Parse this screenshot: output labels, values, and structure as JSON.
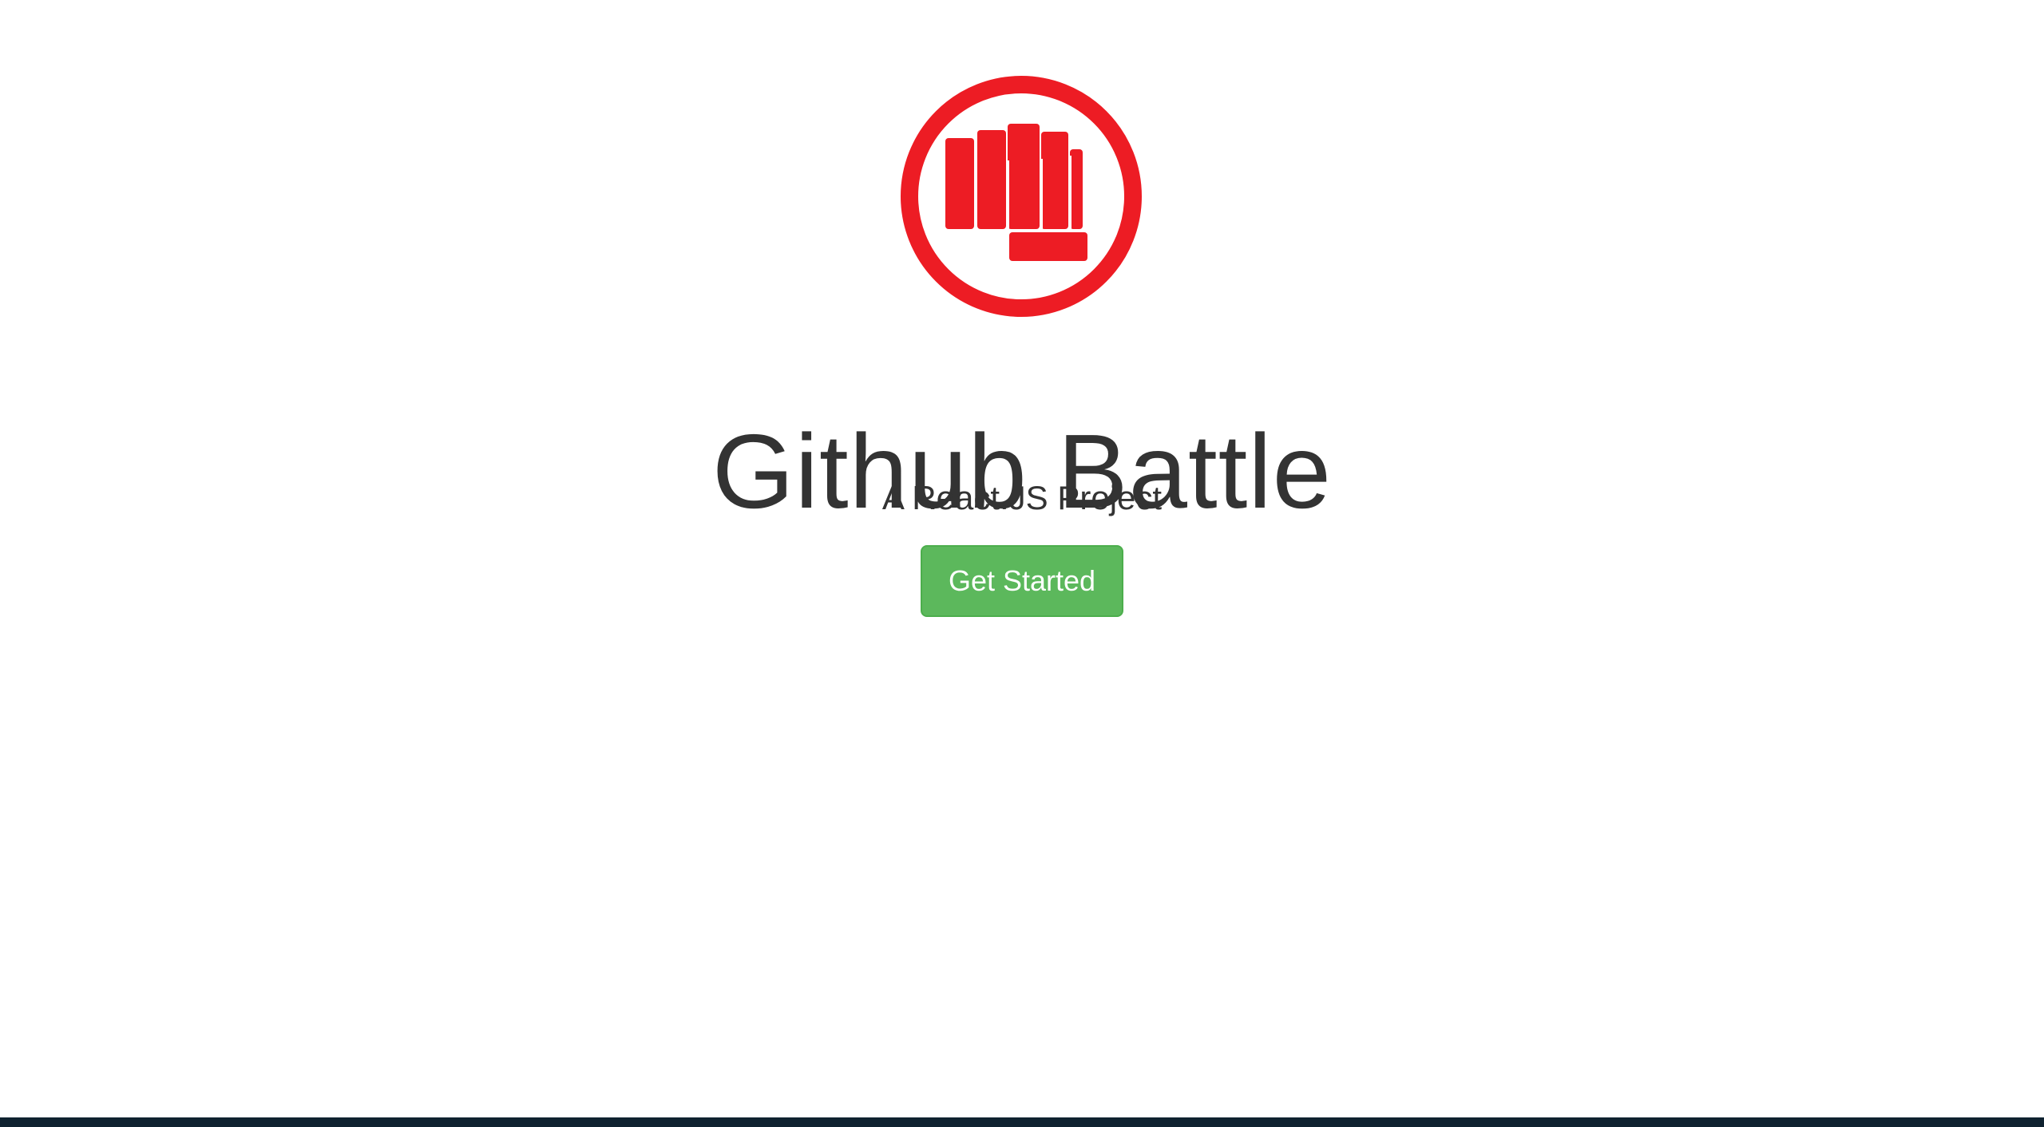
{
  "hero": {
    "logo_icon": "fist-icon",
    "logo_color": "#ed1c24",
    "title": "Github Battle",
    "subtitle": "A React.JS Project",
    "cta_label": "Get Started",
    "cta_color": "#5cb85c"
  },
  "colors": {
    "background": "#ffffff",
    "text": "#333333",
    "bottom_strip": "#0f2230"
  }
}
